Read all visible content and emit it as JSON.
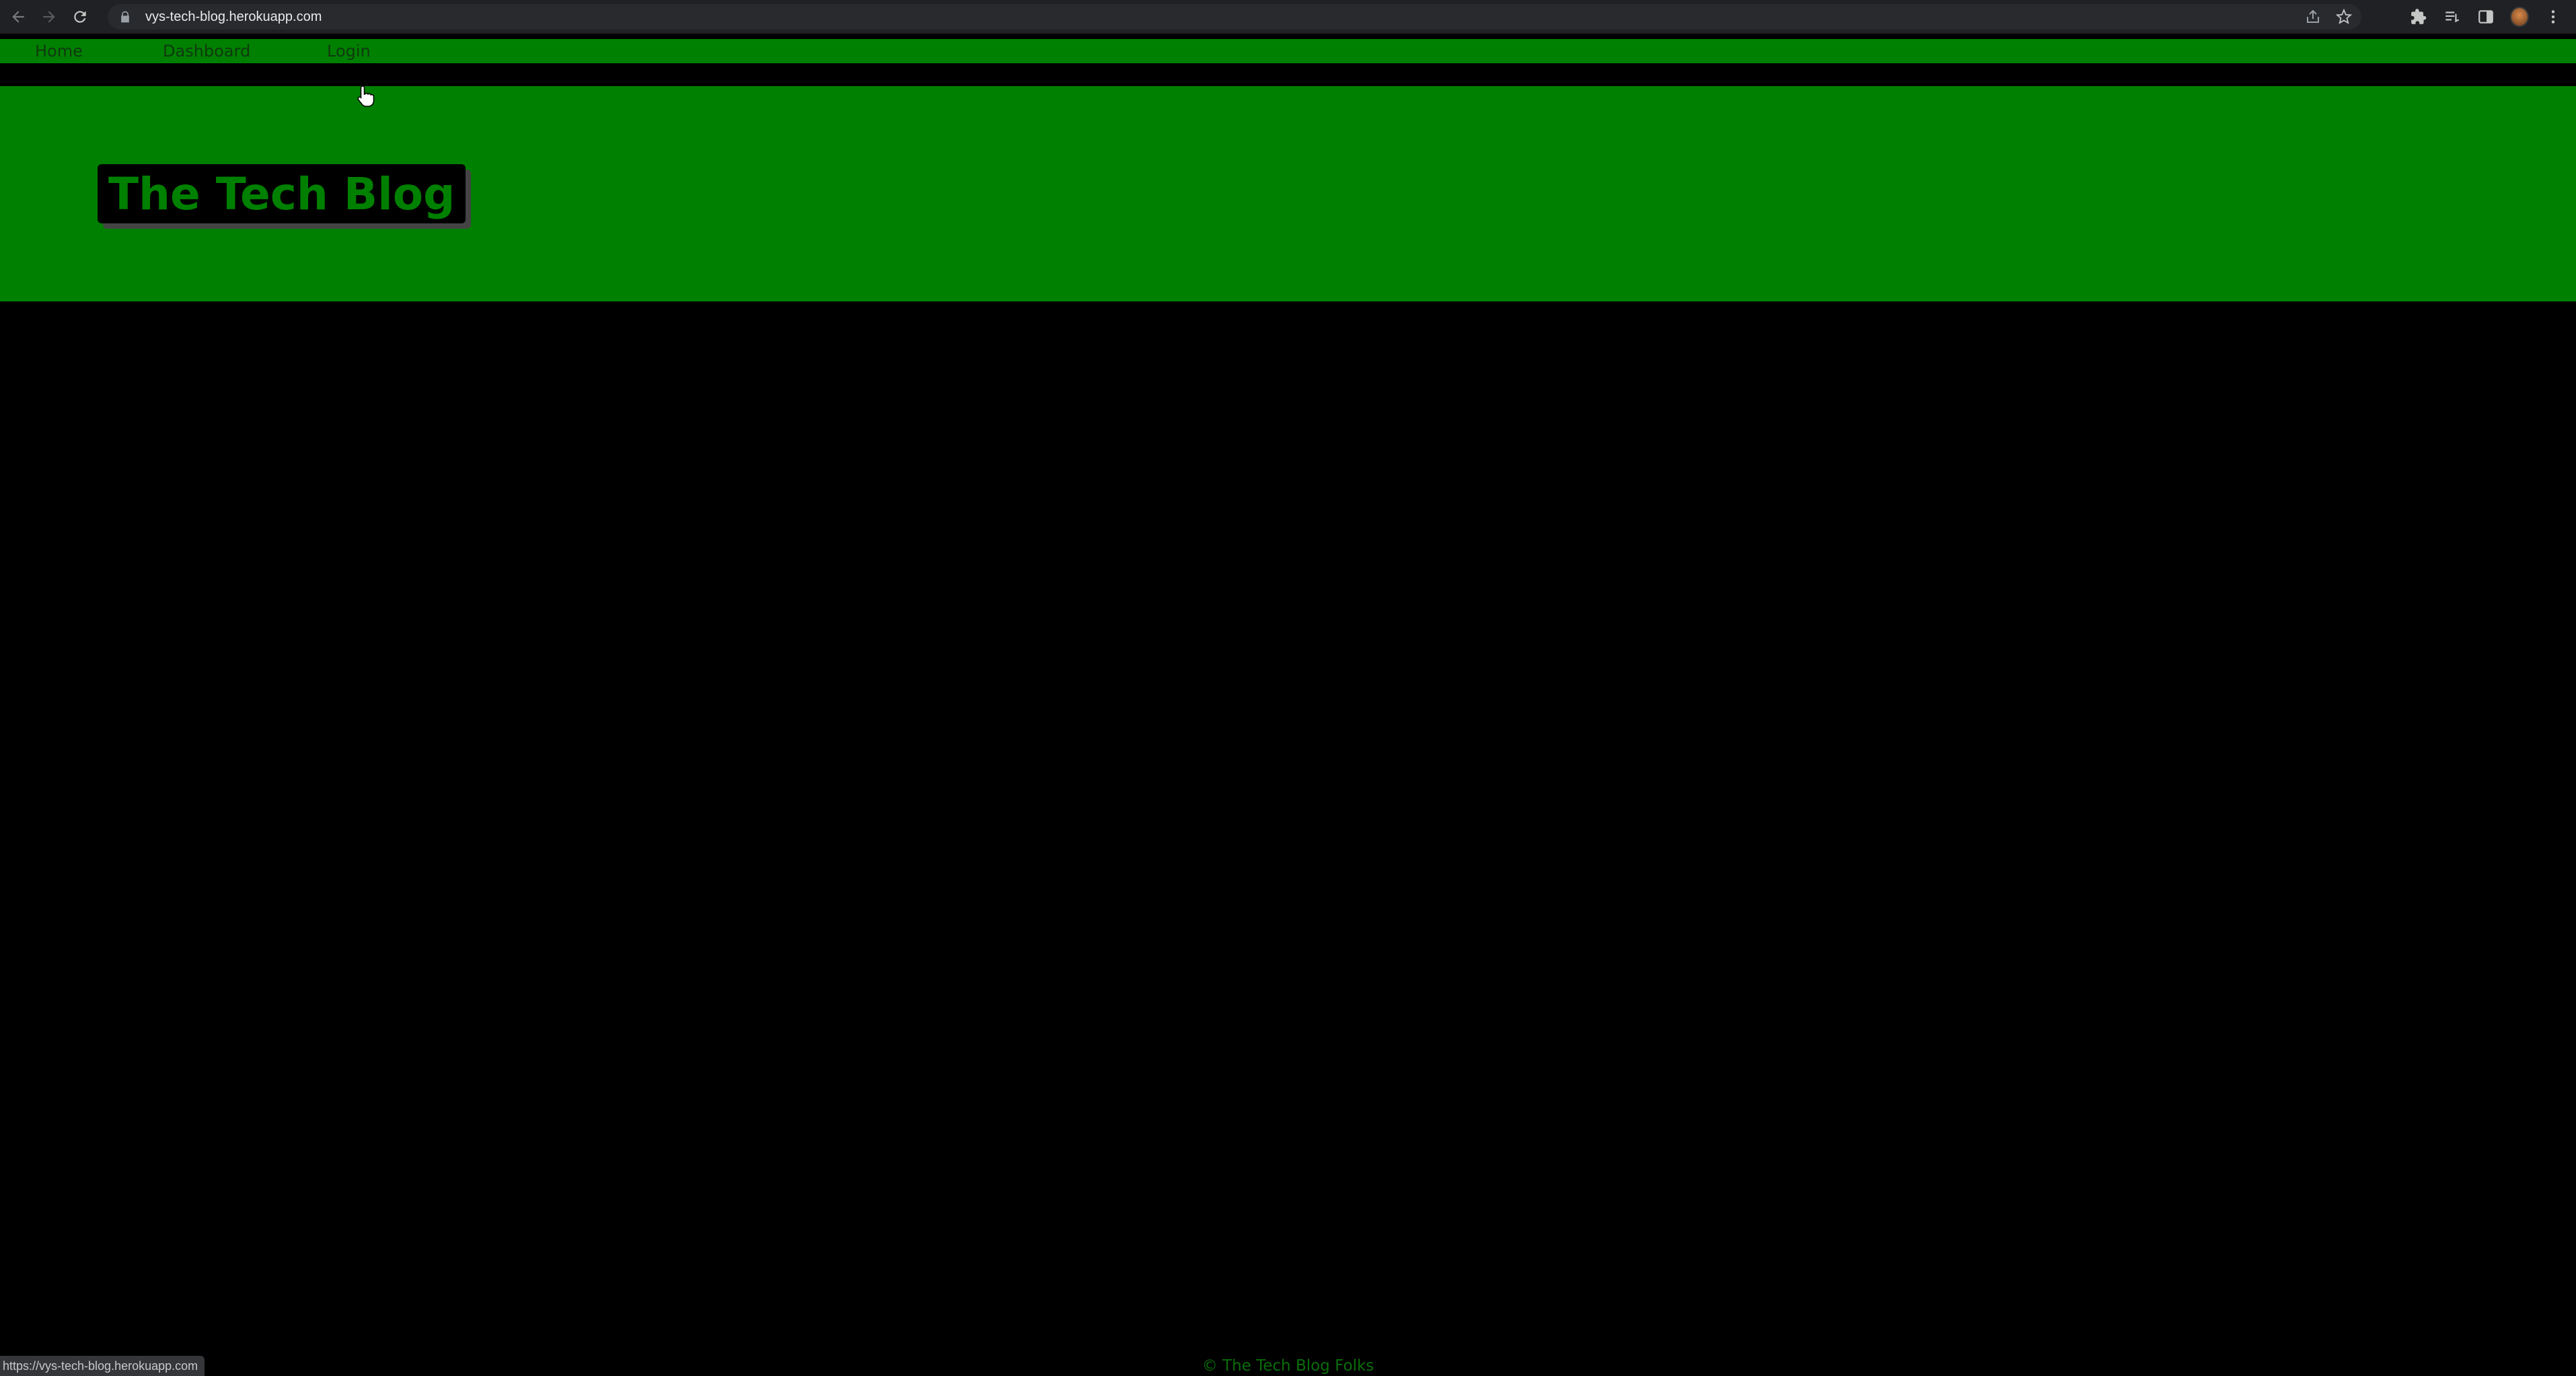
{
  "browser": {
    "url": "vys-tech-blog.herokuapp.com",
    "status_url": "https://vys-tech-blog.herokuapp.com"
  },
  "nav": {
    "home_label": "Home",
    "dashboard_label": "Dashboard",
    "login_label": "Login"
  },
  "header": {
    "site_title": "The Tech Blog"
  },
  "footer": {
    "copyright": "© The Tech Blog Folks"
  },
  "colors": {
    "brand_green": "#008000",
    "background": "#000000",
    "chrome_bg": "#202124"
  }
}
